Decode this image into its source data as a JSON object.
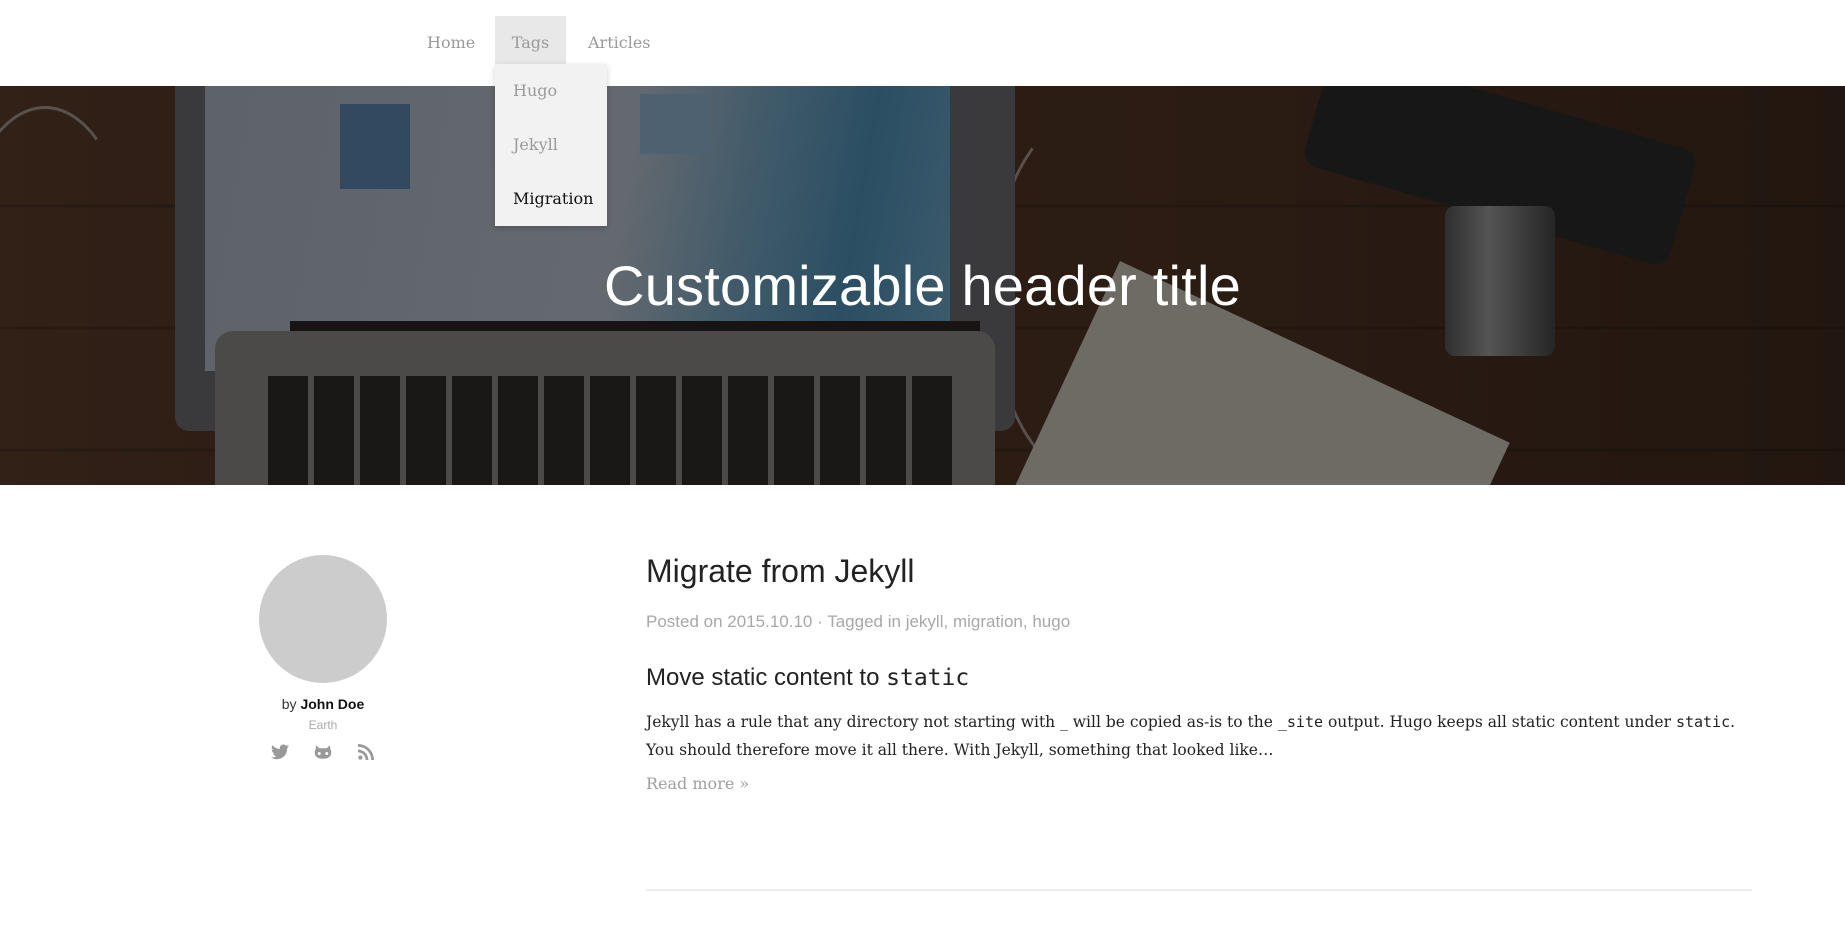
{
  "nav": {
    "items": [
      {
        "label": "Home"
      },
      {
        "label": "Tags"
      },
      {
        "label": "Articles"
      }
    ],
    "active": "Tags",
    "dropdown": {
      "items": [
        {
          "label": "Hugo"
        },
        {
          "label": "Jekyll"
        },
        {
          "label": "Migration"
        }
      ],
      "hovered": "Migration"
    }
  },
  "hero": {
    "title": "Customizable header title"
  },
  "author": {
    "by_prefix": "by",
    "name": "John Doe",
    "location": "Earth",
    "social": [
      {
        "icon": "twitter-icon"
      },
      {
        "icon": "github-icon"
      },
      {
        "icon": "rss-icon"
      }
    ]
  },
  "post": {
    "title": "Migrate from Jekyll",
    "meta": {
      "posted_prefix": "Posted on",
      "date": "2015.10.10",
      "separator": "·",
      "tagged_prefix": "Tagged in",
      "tags": [
        "jekyll",
        "migration",
        "hugo"
      ]
    },
    "subheading": {
      "text": "Move static content to",
      "code": "static"
    },
    "body": {
      "part1": "Jekyll has a rule that any directory not starting with _ will be copied as-is to the ",
      "code1": "_site",
      "part2": " output. Hugo keeps all static content under ",
      "code2": "static",
      "part3": ". You should therefore move it all there. With Jekyll, something that looked like…"
    },
    "read_more": "Read more »"
  },
  "colors": {
    "nav_text": "#9a9a9a",
    "nav_active_bg": "#e8e8e8",
    "dropdown_bg": "#f2f2f2",
    "muted": "#a8a8a8",
    "avatar": "#cccccc"
  }
}
